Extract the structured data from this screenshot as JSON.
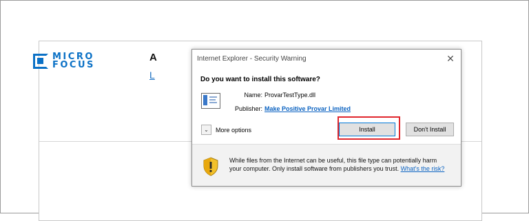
{
  "background": {
    "logo_line1": "MICRO",
    "logo_line2": "FOCUS",
    "peek_heading": "A",
    "peek_link": "L"
  },
  "dialog": {
    "title": "Internet Explorer - Security Warning",
    "close_glyph": "✕",
    "question": "Do you want to install this software?",
    "name_label": "Name:",
    "name_value": "ProvarTestType.dll",
    "publisher_label": "Publisher:",
    "publisher_value": "Make Positive Provar Limited",
    "more_options_label": "More options",
    "more_options_glyph": "⌄",
    "install_label": "Install",
    "dont_install_label": "Don't Install",
    "warning_text": "While files from the Internet can be useful, this file type can potentially harm your computer. Only install software from publishers you trust. ",
    "warning_link": "What's the risk?"
  },
  "colors": {
    "brand_blue": "#0b71c6",
    "link_blue": "#0a62c1",
    "highlight_red": "#e0262c",
    "shield_yellow": "#f3c12a"
  }
}
